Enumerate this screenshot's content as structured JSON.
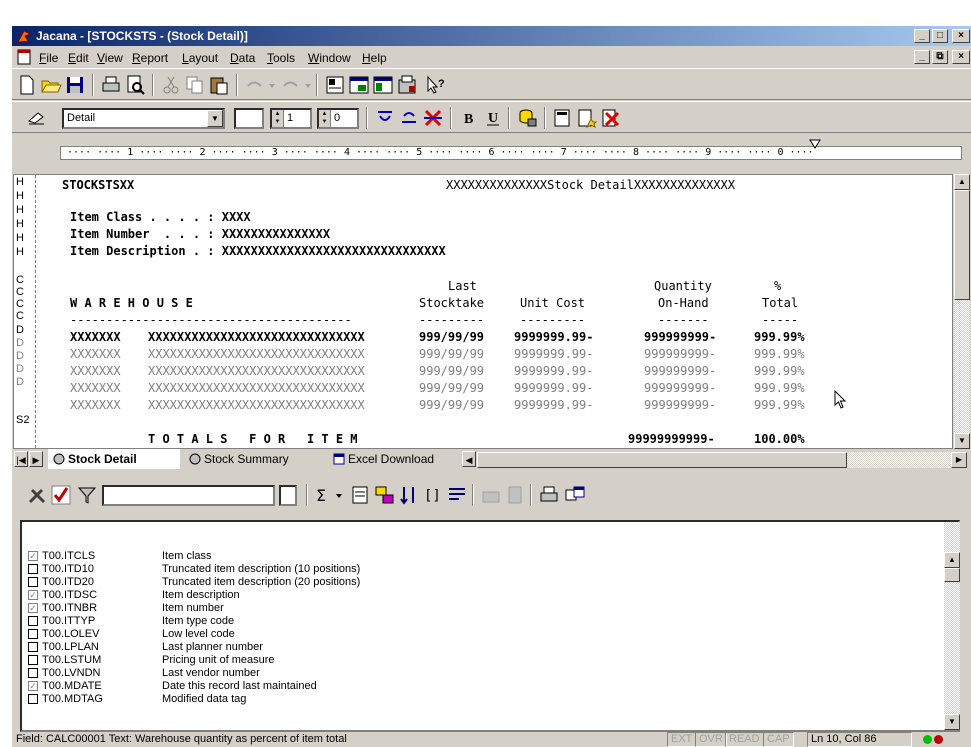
{
  "window": {
    "title": "Jacana - [STOCKSTS - (Stock Detail)]",
    "controls": [
      "_",
      "□",
      "×"
    ],
    "doc_controls": [
      "_",
      "⧉",
      "×"
    ]
  },
  "menu": [
    "File",
    "Edit",
    "View",
    "Report",
    "Layout",
    "Data",
    "Tools",
    "Window",
    "Help"
  ],
  "toolbar2": {
    "section_combo": "Detail",
    "spin1": "1",
    "spin2": "0"
  },
  "ruler": " ···· ···· 1 ···· ···· 2 ···· ···· 3 ···· ···· 4 ···· ···· 5 ···· ···· 6 ···· ···· 7 ···· ···· 8 ···· ···· 9 ···· ···· 0 ····",
  "report": {
    "gutter": [
      {
        "t": "H",
        "dim": false
      },
      {
        "t": "H",
        "dim": false
      },
      {
        "t": "H",
        "dim": false
      },
      {
        "t": "H",
        "dim": false
      },
      {
        "t": "H",
        "dim": false
      },
      {
        "t": "H",
        "dim": false
      },
      {
        "t": "C",
        "dim": false
      },
      {
        "t": "C",
        "dim": false
      },
      {
        "t": "C",
        "dim": false
      },
      {
        "t": "C",
        "dim": false
      },
      {
        "t": "D",
        "dim": false
      },
      {
        "t": "D",
        "dim": true
      },
      {
        "t": "D",
        "dim": true
      },
      {
        "t": "D",
        "dim": true
      },
      {
        "t": "D",
        "dim": true
      },
      {
        "t": "S2",
        "dim": false
      }
    ],
    "program_id": "STOCKSTSXX",
    "report_title": "XXXXXXXXXXXXXXStock DetailXXXXXXXXXXXXXX",
    "header_lines": [
      "Item Class . . . . : XXXX",
      "Item Number  . . . : XXXXXXXXXXXXXXX",
      "Item Description . : XXXXXXXXXXXXXXXXXXXXXXXXXXXXXXX"
    ],
    "col_head_1": {
      "last": "Last",
      "qty": "Quantity",
      "pct": "%"
    },
    "col_head_2": {
      "warehouse": "W A R E H O U S E",
      "stocktake": "Stocktake",
      "unit_cost": "Unit Cost",
      "onhand": "On-Hand",
      "total": "Total"
    },
    "dashes": {
      "wh": "---------------------------------------",
      "st": "---------",
      "uc": "---------",
      "oh": "-------",
      "tt": "-----"
    },
    "detail_rows": [
      {
        "code": "XXXXXXX",
        "desc": "XXXXXXXXXXXXXXXXXXXXXXXXXXXXXX",
        "date": "999/99/99",
        "cost": "9999999.99-",
        "qty": "999999999-",
        "pct": "999.99%",
        "dim": false
      },
      {
        "code": "XXXXXXX",
        "desc": "XXXXXXXXXXXXXXXXXXXXXXXXXXXXXX",
        "date": "999/99/99",
        "cost": "9999999.99-",
        "qty": "999999999-",
        "pct": "999.99%",
        "dim": true
      },
      {
        "code": "XXXXXXX",
        "desc": "XXXXXXXXXXXXXXXXXXXXXXXXXXXXXX",
        "date": "999/99/99",
        "cost": "9999999.99-",
        "qty": "999999999-",
        "pct": "999.99%",
        "dim": true
      },
      {
        "code": "XXXXXXX",
        "desc": "XXXXXXXXXXXXXXXXXXXXXXXXXXXXXX",
        "date": "999/99/99",
        "cost": "9999999.99-",
        "qty": "999999999-",
        "pct": "999.99%",
        "dim": true
      },
      {
        "code": "XXXXXXX",
        "desc": "XXXXXXXXXXXXXXXXXXXXXXXXXXXXXX",
        "date": "999/99/99",
        "cost": "9999999.99-",
        "qty": "999999999-",
        "pct": "999.99%",
        "dim": true
      }
    ],
    "totals_label": "T O T A L S   F O R   I T E M",
    "totals_qty": "99999999999-",
    "totals_pct": "100.00%"
  },
  "tabs": [
    "Stock Detail",
    "Stock Summary",
    "Excel Download"
  ],
  "fields": [
    {
      "name": "T00.ITCLS",
      "desc": "Item class",
      "checked": true
    },
    {
      "name": "T00.ITD10",
      "desc": "Truncated item description (10 positions)",
      "checked": false
    },
    {
      "name": "T00.ITD20",
      "desc": "Truncated item description (20 positions)",
      "checked": false
    },
    {
      "name": "T00.ITDSC",
      "desc": "Item description",
      "checked": true
    },
    {
      "name": "T00.ITNBR",
      "desc": "Item number",
      "checked": true
    },
    {
      "name": "T00.ITTYP",
      "desc": "Item type code",
      "checked": false
    },
    {
      "name": "T00.LOLEV",
      "desc": "Low level code",
      "checked": false
    },
    {
      "name": "T00.LPLAN",
      "desc": "Last planner number",
      "checked": false
    },
    {
      "name": "T00.LSTUM",
      "desc": "Pricing unit of measure",
      "checked": false
    },
    {
      "name": "T00.LVNDN",
      "desc": "Last vendor number",
      "checked": false
    },
    {
      "name": "T00.MDATE",
      "desc": "Date this record last maintained",
      "checked": true
    },
    {
      "name": "T00.MDTAG",
      "desc": "Modified data tag",
      "checked": false
    }
  ],
  "status": {
    "message": "Field: CALC00001  Text: Warehouse quantity as percent of item total",
    "panels": [
      "EXT",
      "OVR",
      "READ",
      "CAP"
    ],
    "position": "Ln 10, Col 86"
  },
  "colors": {
    "title_start": "#0a246a",
    "title_end": "#a6caf0",
    "chrome": "#d4d0c8"
  }
}
